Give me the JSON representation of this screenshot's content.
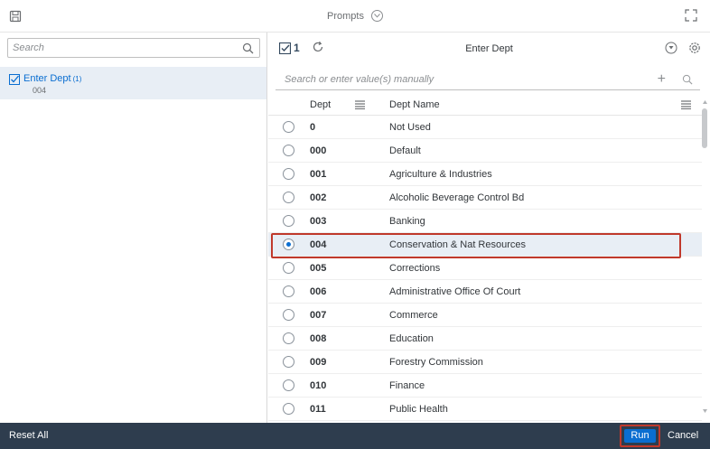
{
  "dialog": {
    "title": "Prompts"
  },
  "left": {
    "search_placeholder": "Search",
    "prompt": {
      "label": "Enter Dept",
      "count": "(1)",
      "value": "004"
    }
  },
  "right": {
    "selected_count": "1",
    "prompt_title": "Enter Dept",
    "search_placeholder": "Search or enter value(s) manually",
    "columns": {
      "code": "Dept",
      "name": "Dept Name"
    },
    "rows": [
      {
        "code": "0",
        "name": "Not Used",
        "selected": false
      },
      {
        "code": "000",
        "name": "Default",
        "selected": false
      },
      {
        "code": "001",
        "name": "Agriculture & Industries",
        "selected": false
      },
      {
        "code": "002",
        "name": "Alcoholic Beverage Control Bd",
        "selected": false
      },
      {
        "code": "003",
        "name": "Banking",
        "selected": false
      },
      {
        "code": "004",
        "name": "Conservation & Nat Resources",
        "selected": true
      },
      {
        "code": "005",
        "name": "Corrections",
        "selected": false
      },
      {
        "code": "006",
        "name": "Administrative Office Of Court",
        "selected": false
      },
      {
        "code": "007",
        "name": "Commerce",
        "selected": false
      },
      {
        "code": "008",
        "name": "Education",
        "selected": false
      },
      {
        "code": "009",
        "name": "Forestry Commission",
        "selected": false
      },
      {
        "code": "010",
        "name": "Finance",
        "selected": false
      },
      {
        "code": "011",
        "name": "Public Health",
        "selected": false
      }
    ]
  },
  "footer": {
    "reset_label": "Reset All",
    "run_label": "Run",
    "cancel_label": "Cancel"
  },
  "colors": {
    "accent": "#0a6ed1",
    "footer_bg": "#2e3d4e",
    "highlight_border": "#c0392b",
    "selected_bg": "#e8eef5"
  },
  "icons": {
    "dialog": "save-icon",
    "expand": "expand-icon",
    "search": "search-icon",
    "check": "checkbox-icon",
    "refresh": "refresh-icon",
    "settings": "gear-icon",
    "column_menu": "column-menu-icon",
    "add": "plus-icon"
  }
}
